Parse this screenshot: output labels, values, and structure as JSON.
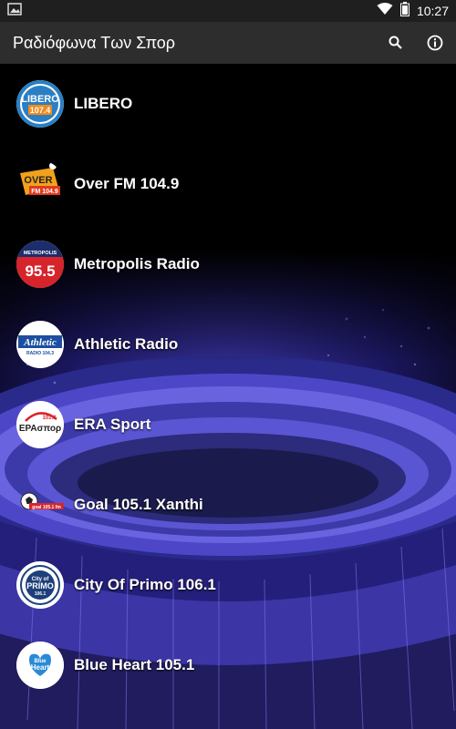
{
  "status": {
    "time": "10:27"
  },
  "appbar": {
    "title": "Ραδιόφωνα Των Σπορ"
  },
  "stations": [
    {
      "label": "LIBERO",
      "logo": {
        "line1": "LIBERO",
        "line2": "107.4"
      }
    },
    {
      "label": "Over FM 104.9",
      "logo": {
        "line1": "OVER",
        "line2": "FM 104.9"
      }
    },
    {
      "label": "Metropolis Radio",
      "logo": {
        "line1": "METROPOLIS",
        "line2": "95.5"
      }
    },
    {
      "label": "Athletic Radio",
      "logo": {
        "line1": "Athletic",
        "line2": "RADIO 104.3"
      }
    },
    {
      "label": "ERA Sport",
      "logo": {
        "line1": "101.8",
        "line2": "ΕΡΑσπορ"
      }
    },
    {
      "label": "Goal 105.1 Xanthi",
      "logo": {
        "line1": "goal 105.1 fm"
      }
    },
    {
      "label": "City Of Primo 106.1",
      "logo": {
        "line1": "City of",
        "line2": "PRIMO",
        "line3": "106.1"
      }
    },
    {
      "label": "Blue Heart 105.1",
      "logo": {
        "line1": "Blue",
        "line2": "Heart"
      }
    }
  ]
}
